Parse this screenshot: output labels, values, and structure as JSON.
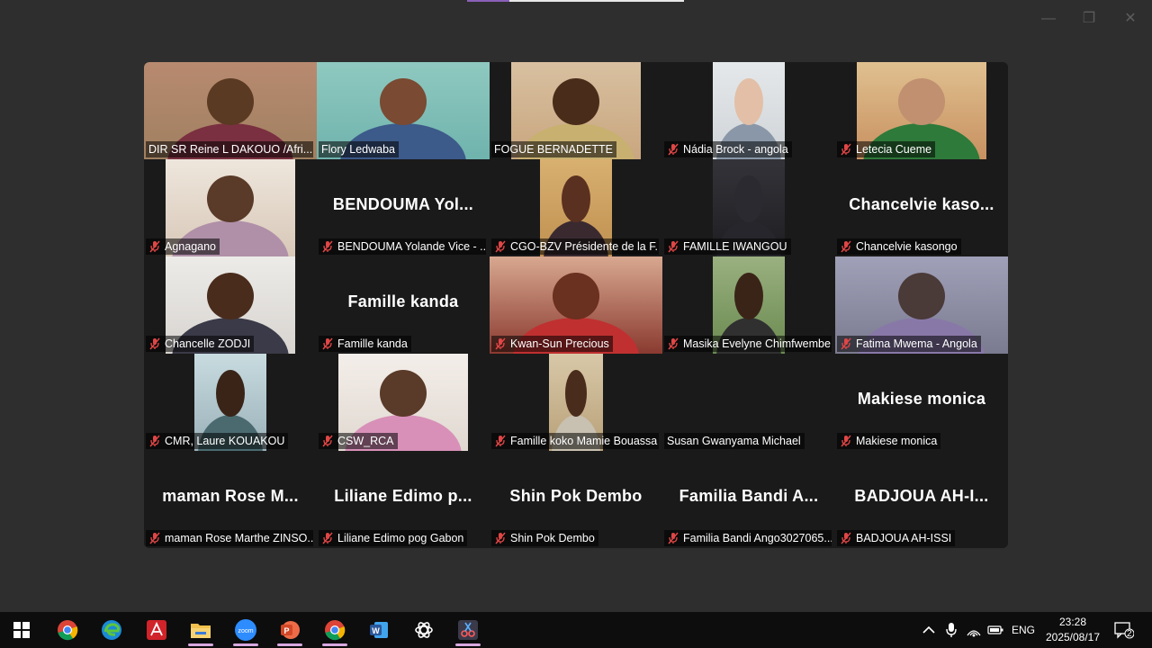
{
  "window": {
    "min_icon": "minimize-icon",
    "max_icon": "maximize-icon",
    "close_icon": "close-icon"
  },
  "colors": {
    "active_speaker": "#23d18b",
    "muted_mic": "#e04646",
    "background": "#2e2e2e",
    "grid": "#1a1a1a"
  },
  "participants": [
    {
      "label": "DIR SR  Reine L  DAKOUO /Afri...",
      "muted": false,
      "video": {
        "w": 192,
        "bg": "#a08060",
        "skin": "#5a3a22",
        "cloth": "#7a3040",
        "back": "#b88a70"
      }
    },
    {
      "label": "Flory Ledwaba",
      "muted": false,
      "active": true,
      "video": {
        "w": 192,
        "bg": "#6fb3ad",
        "skin": "#7a4a32",
        "cloth": "#3c5a8a",
        "back": "#8fc9c0"
      }
    },
    {
      "label": "FOGUE BERNADETTE",
      "muted": false,
      "video": {
        "w": 144,
        "bg": "#c9a67f",
        "skin": "#4a2c1a",
        "cloth": "#c8b070",
        "back": "#d8c0a0"
      }
    },
    {
      "label": "Nádia Brock - angola",
      "muted": true,
      "video": {
        "w": 80,
        "bg": "#cfd4d8",
        "skin": "#e2bfa6",
        "cloth": "#8a97a8",
        "back": "#e5e8ea"
      }
    },
    {
      "label": "Letecia Cueme",
      "muted": true,
      "video": {
        "w": 144,
        "bg": "#c89060",
        "skin": "#c09070",
        "cloth": "#2d7a3a",
        "back": "#e0c090"
      }
    },
    {
      "label": "Agnagano",
      "muted": true,
      "video": {
        "w": 144,
        "bg": "#d8c8b8",
        "skin": "#5a3a28",
        "cloth": "#b090a8",
        "back": "#eee6dc"
      }
    },
    {
      "label": "BENDOUMA Yolande Vice - ...",
      "muted": true,
      "big": "BENDOUMA  Yol..."
    },
    {
      "label": "CGO-BZV Présidente de la F...",
      "muted": true,
      "video": {
        "w": 80,
        "bg": "#c09050",
        "skin": "#5a3020",
        "cloth": "#3a2a30",
        "back": "#d8b070"
      }
    },
    {
      "label": "FAMILLE IWANGOU",
      "muted": true,
      "video": {
        "w": 80,
        "bg": "#1e1e22",
        "skin": "#2a2a30",
        "cloth": "#26262c",
        "back": "#333339"
      }
    },
    {
      "label": "Chancelvie kasongo",
      "muted": true,
      "big": "Chancelvie  kaso..."
    },
    {
      "label": "Chancelle ZODJI",
      "muted": true,
      "video": {
        "w": 144,
        "bg": "#d8d4d0",
        "skin": "#4a2c1c",
        "cloth": "#3a3a48",
        "back": "#ecebe8"
      }
    },
    {
      "label": "Famille kanda",
      "muted": true,
      "big": "Famille kanda"
    },
    {
      "label": "Kwan-Sun Precious",
      "muted": true,
      "video": {
        "w": 192,
        "bg": "#8a3a30",
        "skin": "#6a3020",
        "cloth": "#c03030",
        "back": "#d8a890"
      }
    },
    {
      "label": "Masika Evelyne Chimfwembe",
      "muted": true,
      "video": {
        "w": 80,
        "bg": "#6a8a50",
        "skin": "#3a2418",
        "cloth": "#303030",
        "back": "#9ab080"
      }
    },
    {
      "label": "Fatima Mwema - Angola",
      "muted": true,
      "video": {
        "w": 192,
        "bg": "#7a7a90",
        "skin": "#4a3a38",
        "cloth": "#8878a8",
        "back": "#a0a0b8"
      }
    },
    {
      "label": "CMR, Laure KOUAKOU",
      "muted": true,
      "video": {
        "w": 80,
        "bg": "#9ab0b8",
        "skin": "#3a2418",
        "cloth": "#4a6a70",
        "back": "#c8dce0"
      }
    },
    {
      "label": "CSW_RCA",
      "muted": true,
      "video": {
        "w": 144,
        "bg": "#e0d8d0",
        "skin": "#5a3a28",
        "cloth": "#d890b8",
        "back": "#f4eeea"
      }
    },
    {
      "label": "Famille koko Mamie Bouassa",
      "muted": true,
      "video": {
        "w": 60,
        "bg": "#b8a078",
        "skin": "#4a2c1c",
        "cloth": "#c8c0b0",
        "back": "#d8c8a8"
      }
    },
    {
      "label": "Susan Gwanyama Michael",
      "muted": false
    },
    {
      "label": "Makiese monica",
      "muted": true,
      "big": "Makiese monica"
    },
    {
      "label": "maman  Rose Marthe ZINSO...",
      "muted": true,
      "big": "maman   Rose M..."
    },
    {
      "label": "Liliane Edimo pog  Gabon",
      "muted": true,
      "big": "Liliane  Edimo  p..."
    },
    {
      "label": "Shin Pok  Dembo",
      "muted": true,
      "big": "Shin Pok  Dembo"
    },
    {
      "label": "Familia Bandi Ango3027065...",
      "muted": true,
      "big": "Familia  Bandi  A..."
    },
    {
      "label": "BADJOUA AH-ISSI",
      "muted": true,
      "big": "BADJOUA  AH-I..."
    }
  ],
  "taskbar": {
    "apps": [
      {
        "name": "windows-start-icon",
        "color": "#ffffff"
      },
      {
        "name": "chrome-icon",
        "color": "#e6b229"
      },
      {
        "name": "edge-icon",
        "color": "#2a9fd8"
      },
      {
        "name": "acrobat-icon",
        "color": "#d0232a"
      },
      {
        "name": "file-explorer-icon",
        "color": "#f2c14e",
        "open": true
      },
      {
        "name": "zoom-icon",
        "color": "#2d8cff",
        "open": true,
        "label": "zoom"
      },
      {
        "name": "powerpoint-icon",
        "color": "#d24726",
        "open": true,
        "label": "P"
      },
      {
        "name": "chrome-profile-icon",
        "color": "#e6b229",
        "open": true
      },
      {
        "name": "word-icon",
        "color": "#2b579a",
        "label": "W"
      },
      {
        "name": "chatgpt-icon",
        "color": "#ffffff"
      },
      {
        "name": "snipping-tool-icon",
        "color": "#c060c0",
        "open": true
      }
    ],
    "lang": "ENG",
    "time": "23:28",
    "date": "2025/08/17",
    "notifications": "2"
  }
}
